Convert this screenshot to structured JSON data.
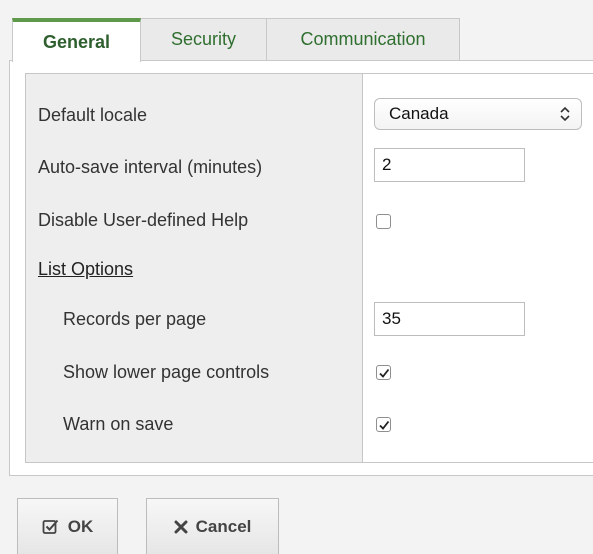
{
  "tabs": [
    {
      "label": "General",
      "active": true
    },
    {
      "label": "Security",
      "active": false
    },
    {
      "label": "Communication",
      "active": false
    }
  ],
  "form": {
    "default_locale": {
      "label": "Default locale",
      "value": "Canada"
    },
    "autosave": {
      "label": "Auto-save interval (minutes)",
      "value": "2"
    },
    "disable_help": {
      "label": "Disable User-defined Help",
      "checked": false
    },
    "list_options": {
      "label": "List Options"
    },
    "records_per_page": {
      "label": "Records per page",
      "value": "35"
    },
    "show_lower_controls": {
      "label": "Show lower page controls",
      "checked": true
    },
    "warn_on_save": {
      "label": "Warn on save",
      "checked": true
    }
  },
  "buttons": {
    "ok": {
      "label": "OK",
      "icon": "checkbox-icon"
    },
    "cancel": {
      "label": "Cancel",
      "icon": "x-icon"
    }
  },
  "colors": {
    "tab_accent": "#5f9a4a",
    "tab_text": "#2f6f2f",
    "label_bg": "#eeeeee"
  }
}
